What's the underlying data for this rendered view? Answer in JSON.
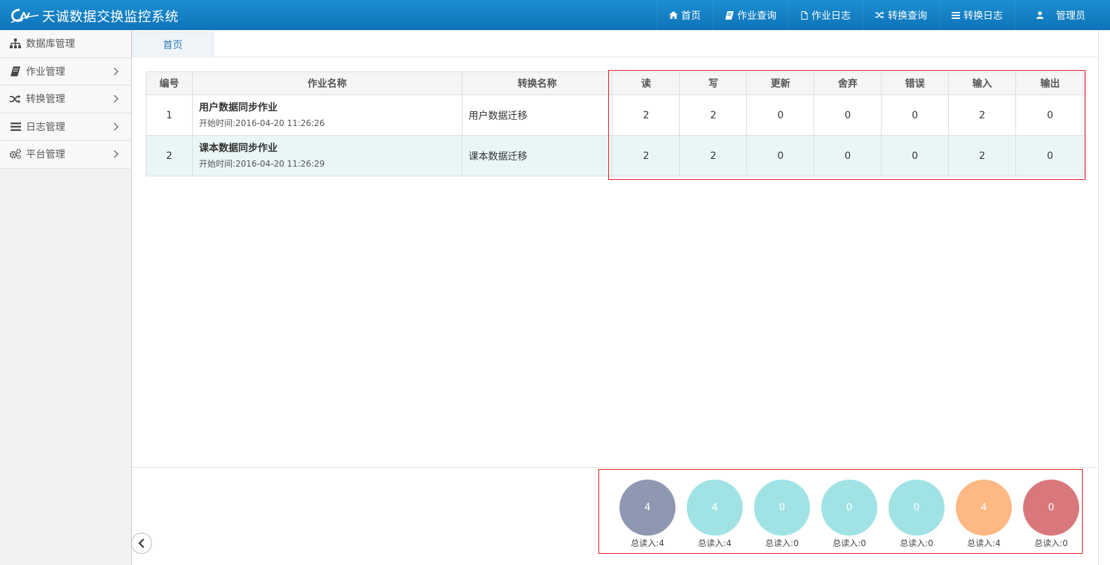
{
  "app": {
    "title": "天诚数据交换监控系统"
  },
  "nav": {
    "items": [
      {
        "label": "首页",
        "icon": "home-icon"
      },
      {
        "label": "作业查询",
        "icon": "book-icon"
      },
      {
        "label": "作业日志",
        "icon": "file-icon"
      },
      {
        "label": "转换查询",
        "icon": "random-icon"
      },
      {
        "label": "转换日志",
        "icon": "list-icon"
      }
    ],
    "user": {
      "label": "管理员",
      "icon": "user-icon"
    }
  },
  "sidebar": {
    "items": [
      {
        "label": "数据库管理",
        "icon": "sitemap-icon",
        "has_chevron": false
      },
      {
        "label": "作业管理",
        "icon": "book-icon",
        "has_chevron": true
      },
      {
        "label": "转换管理",
        "icon": "random-icon",
        "has_chevron": true
      },
      {
        "label": "日志管理",
        "icon": "list-icon",
        "has_chevron": true
      },
      {
        "label": "平台管理",
        "icon": "cogs-icon",
        "has_chevron": true
      }
    ]
  },
  "tabs": [
    {
      "label": "首页"
    }
  ],
  "table": {
    "headers": [
      "编号",
      "作业名称",
      "转换名称",
      "读",
      "写",
      "更新",
      "舍弃",
      "错误",
      "输入",
      "输出"
    ],
    "rows": [
      {
        "id": "1",
        "job_name": "用户数据同步作业",
        "start_time": "开始时间:2016-04-20 11:26:26",
        "trans_name": "用户数据迁移",
        "read": "2",
        "write": "2",
        "update": "0",
        "discard": "0",
        "error": "0",
        "input": "2",
        "output": "0"
      },
      {
        "id": "2",
        "job_name": "课本数据同步作业",
        "start_time": "开始时间:2016-04-20 11:26:29",
        "trans_name": "课本数据迁移",
        "read": "2",
        "write": "2",
        "update": "0",
        "discard": "0",
        "error": "0",
        "input": "2",
        "output": "0"
      }
    ]
  },
  "summary": {
    "circles": [
      {
        "value": "4",
        "label": "总读入:4",
        "color": "#8e98b1"
      },
      {
        "value": "4",
        "label": "总读入:4",
        "color": "#a1e3e5"
      },
      {
        "value": "0",
        "label": "总读入:0",
        "color": "#a1e3e5"
      },
      {
        "value": "0",
        "label": "总读入:0",
        "color": "#a1e3e5"
      },
      {
        "value": "0",
        "label": "总读入:0",
        "color": "#a1e3e5"
      },
      {
        "value": "4",
        "label": "总读入:4",
        "color": "#fdb884"
      },
      {
        "value": "0",
        "label": "总读入:0",
        "color": "#d8787c"
      }
    ]
  },
  "colors": {
    "nav_bg": "#137fc4",
    "highlight_border": "#e4141e",
    "tab_text": "#337ab7"
  }
}
